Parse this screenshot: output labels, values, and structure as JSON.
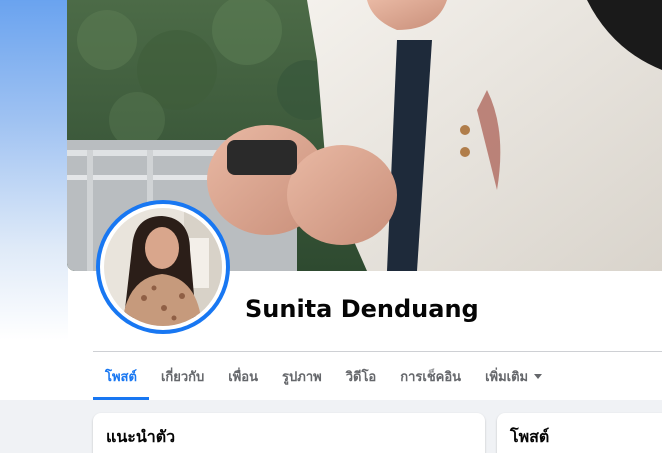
{
  "profile": {
    "name": "Sunita Denduang"
  },
  "tabs": [
    {
      "label": "โพสต์",
      "active": true
    },
    {
      "label": "เกี่ยวกับ",
      "active": false
    },
    {
      "label": "เพื่อน",
      "active": false
    },
    {
      "label": "รูปภาพ",
      "active": false
    },
    {
      "label": "วิดีโอ",
      "active": false
    },
    {
      "label": "การเช็คอิน",
      "active": false
    },
    {
      "label": "เพิ่มเติม",
      "active": false
    }
  ],
  "cards": {
    "intro_title": "แนะนำตัว",
    "posts_title": "โพสต์"
  },
  "colors": {
    "accent": "#1877f2",
    "tab_inactive": "#65676b",
    "text": "#050505",
    "background": "#f0f2f5"
  },
  "icons": {
    "more_tab": "caret-down-icon"
  }
}
